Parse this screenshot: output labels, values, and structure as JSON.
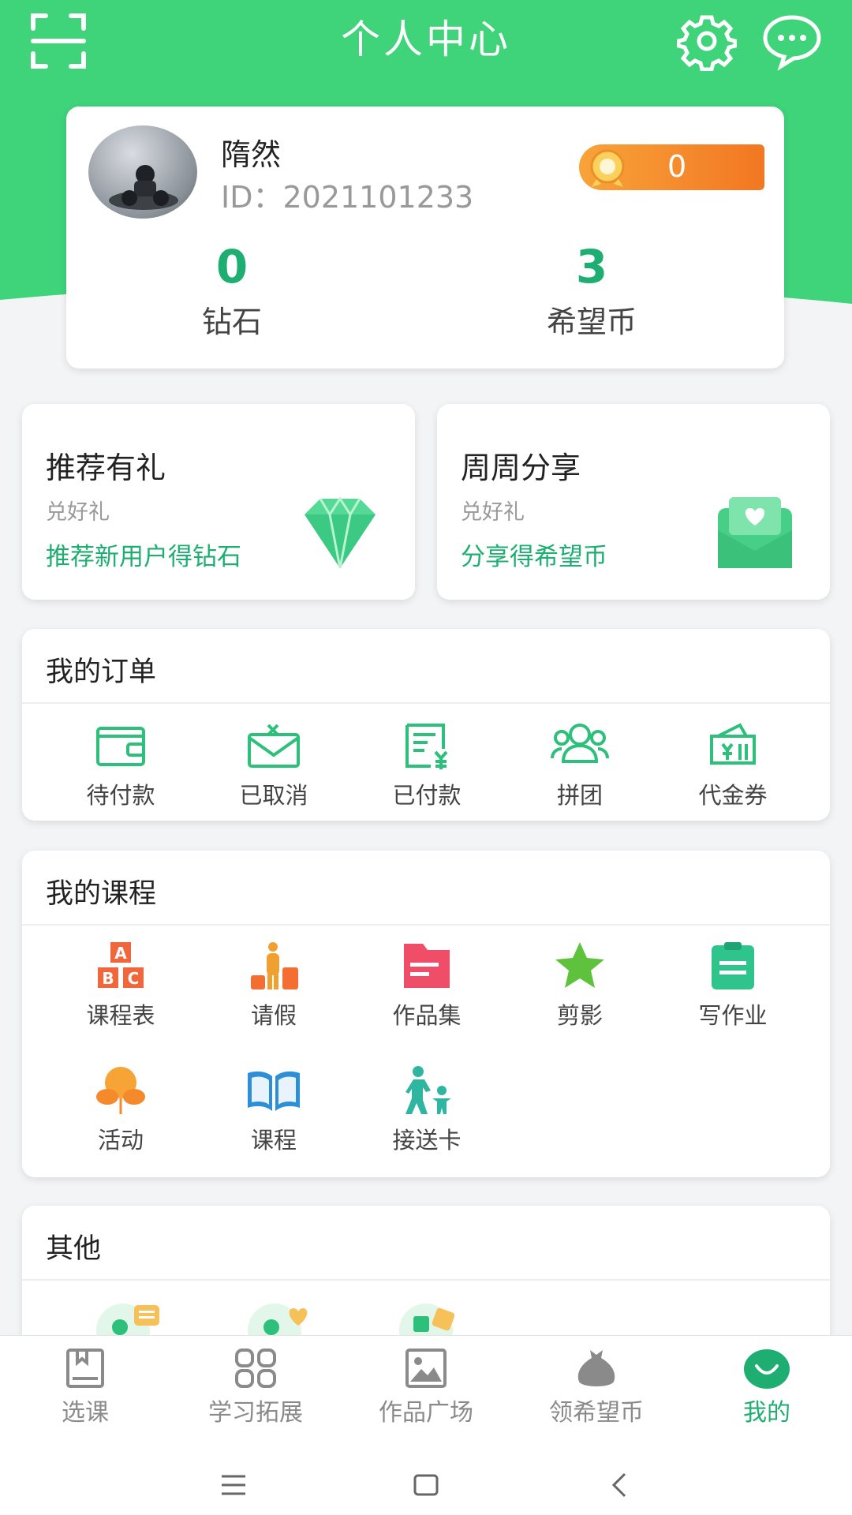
{
  "topbar": {
    "title": "个人中心",
    "left_icon": "scan-icon",
    "right_icons": [
      "gear-icon",
      "message-icon"
    ]
  },
  "profile": {
    "name": "隋然",
    "id_text": "ID：2021101233",
    "coin_badge_count": "0",
    "stats": [
      {
        "value": "0",
        "label": "钻石"
      },
      {
        "value": "3",
        "label": "希望币"
      }
    ]
  },
  "promos": [
    {
      "title": "推荐有礼",
      "subtitle": "兑好礼",
      "action": "推荐新用户得钻石",
      "icon": "diamond-icon"
    },
    {
      "title": "周周分享",
      "subtitle": "兑好礼",
      "action": "分享得希望币",
      "icon": "envelope-heart-icon"
    }
  ],
  "orders": {
    "title": "我的订单",
    "items": [
      {
        "label": "待付款",
        "icon": "wallet-icon"
      },
      {
        "label": "已取消",
        "icon": "cancelled-mail-icon"
      },
      {
        "label": "已付款",
        "icon": "paid-receipt-icon"
      },
      {
        "label": "拼团",
        "icon": "group-icon"
      },
      {
        "label": "代金券",
        "icon": "voucher-icon"
      }
    ]
  },
  "courses": {
    "title": "我的课程",
    "items": [
      {
        "label": "课程表",
        "icon": "abc-blocks-icon"
      },
      {
        "label": "请假",
        "icon": "traveler-luggage-icon"
      },
      {
        "label": "作品集",
        "icon": "folder-icon"
      },
      {
        "label": "剪影",
        "icon": "star-icon"
      },
      {
        "label": "写作业",
        "icon": "clipboard-icon"
      },
      {
        "label": "活动",
        "icon": "balloon-icon"
      },
      {
        "label": "课程",
        "icon": "open-book-icon"
      },
      {
        "label": "接送卡",
        "icon": "parent-child-icon"
      }
    ]
  },
  "other": {
    "title": "其他"
  },
  "bottom_nav": [
    {
      "label": "选课",
      "icon": "course-book-icon",
      "active": false
    },
    {
      "label": "学习拓展",
      "icon": "four-squares-icon",
      "active": false
    },
    {
      "label": "作品广场",
      "icon": "picture-icon",
      "active": false
    },
    {
      "label": "领希望币",
      "icon": "money-bag-icon",
      "active": false
    },
    {
      "label": "我的",
      "icon": "smile-icon",
      "active": true
    }
  ],
  "colors": {
    "brand_green": "#3fd37a",
    "accent_teal": "#1fae72",
    "coin_orange": "#f27722"
  }
}
